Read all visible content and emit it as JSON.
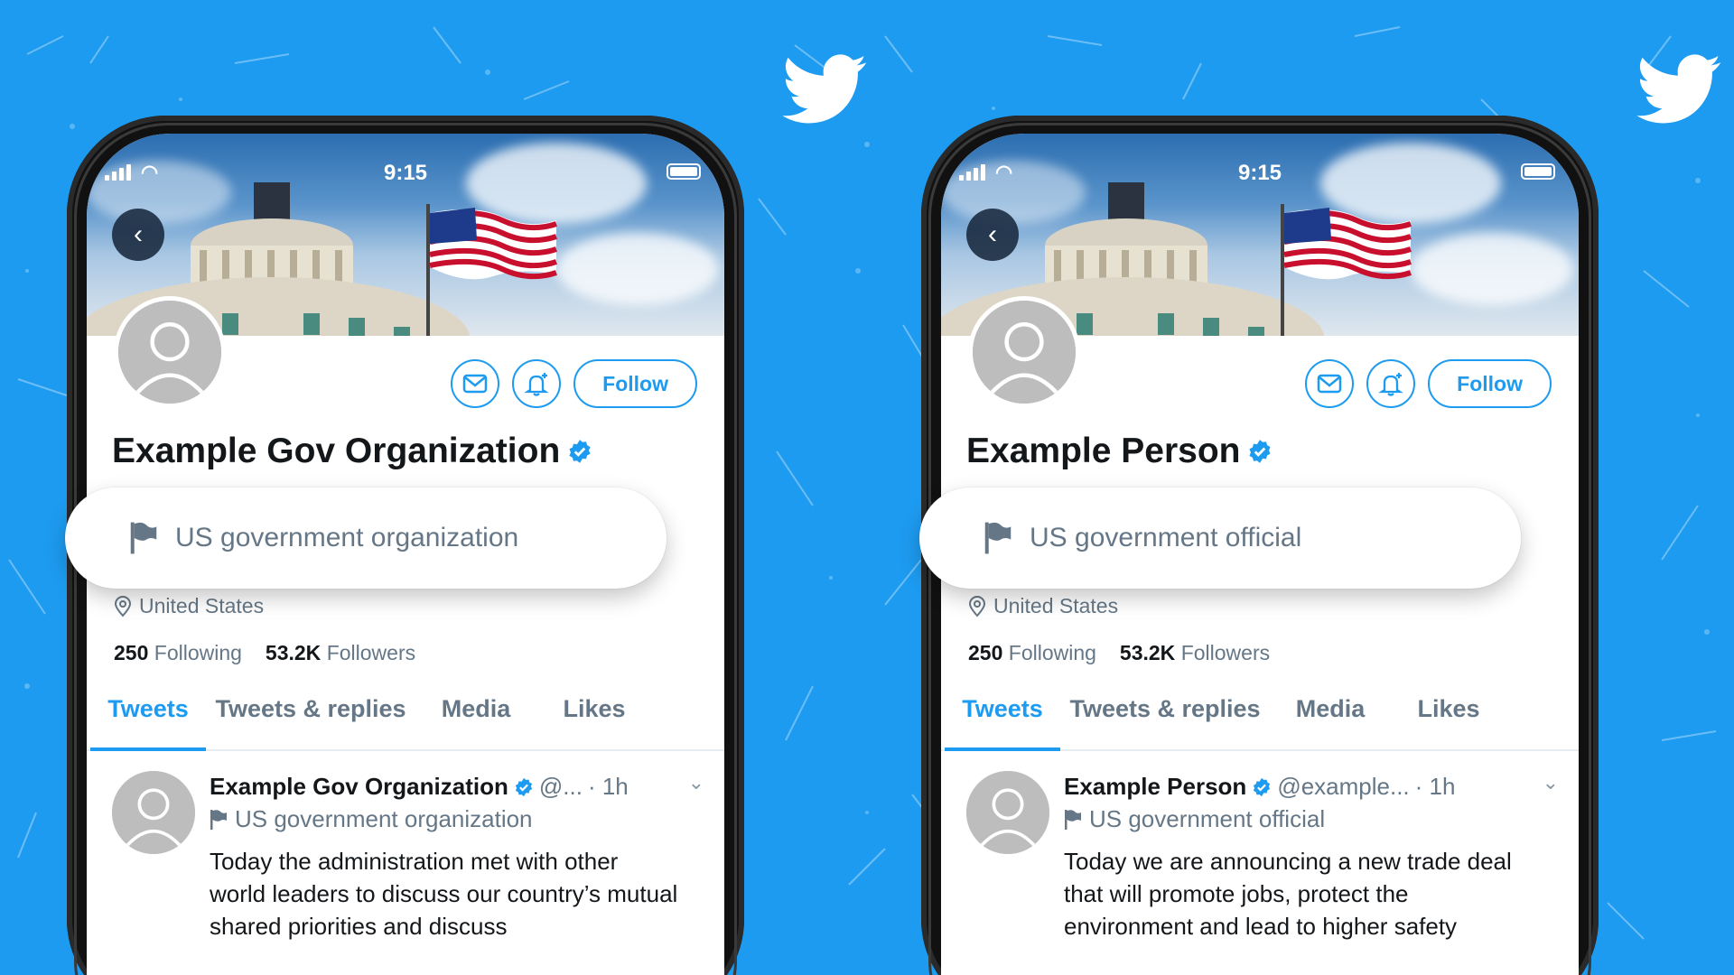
{
  "colors": {
    "background": "#1d9bf0",
    "accent": "#1d9bf0",
    "text_primary": "#14171a",
    "text_secondary": "#657786"
  },
  "phones": [
    {
      "status": {
        "time": "9:15"
      },
      "profile": {
        "name": "Example Gov Organization",
        "follow_label": "Follow"
      },
      "label_pill": {
        "text": "US government organization"
      },
      "location": "United States",
      "stats": {
        "following_count": "250",
        "following_label": "Following",
        "followers_count": "53.2K",
        "followers_label": "Followers"
      },
      "tabs": [
        "Tweets",
        "Tweets & replies",
        "Media",
        "Likes"
      ],
      "tweet": {
        "name": "Example Gov Organization",
        "handle": "@...",
        "time": "· 1h",
        "label": "US government organization",
        "text": "Today the administration met with other world leaders to discuss our country’s mutual shared priorities and discuss"
      }
    },
    {
      "status": {
        "time": "9:15"
      },
      "profile": {
        "name": "Example Person",
        "follow_label": "Follow"
      },
      "label_pill": {
        "text": "US government official"
      },
      "location": "United States",
      "stats": {
        "following_count": "250",
        "following_label": "Following",
        "followers_count": "53.2K",
        "followers_label": "Followers"
      },
      "tabs": [
        "Tweets",
        "Tweets & replies",
        "Media",
        "Likes"
      ],
      "tweet": {
        "name": "Example Person",
        "handle": "@example...",
        "time": "· 1h",
        "label": "US government official",
        "text": "Today we are announcing a new trade deal that will promote jobs, protect the environment and lead to higher safety"
      }
    }
  ],
  "icons": [
    "twitter-bird-icon",
    "back-arrow-icon",
    "mail-icon",
    "bell-plus-icon",
    "verified-badge-icon",
    "flag-icon",
    "location-pin-icon",
    "chevron-down-icon",
    "default-avatar-icon"
  ]
}
